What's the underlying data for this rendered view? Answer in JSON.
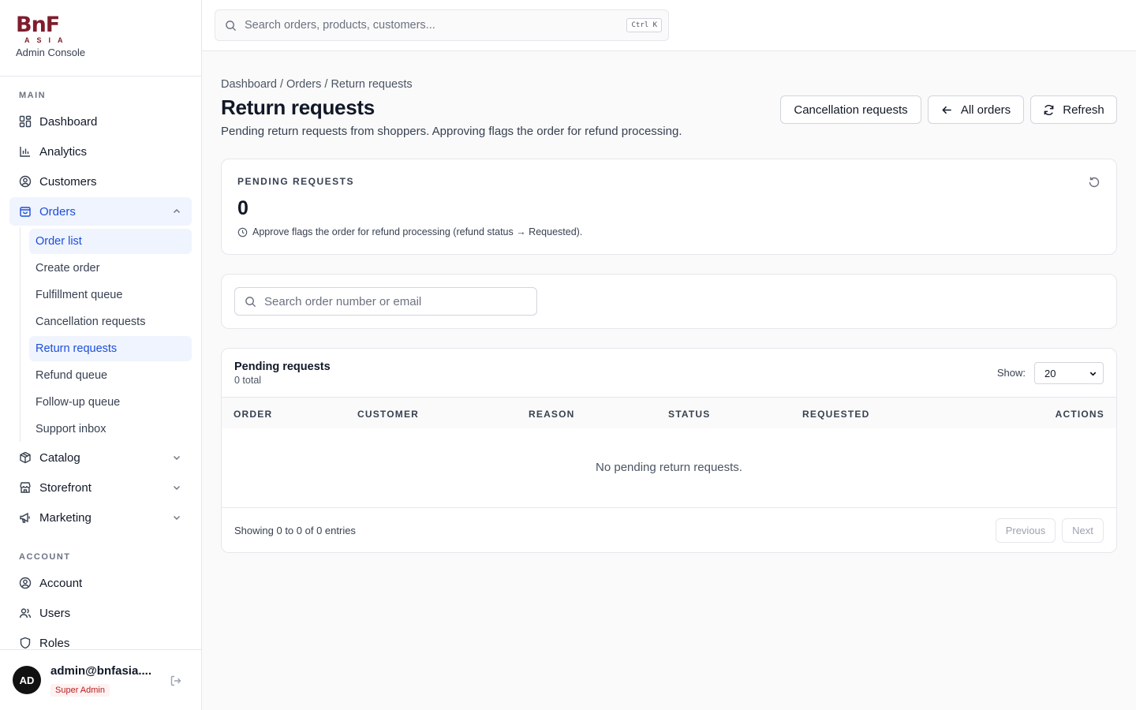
{
  "brand": {
    "logo_text": "BnF",
    "logo_sub": "ASIA",
    "caption": "Admin Console"
  },
  "search": {
    "placeholder": "Search orders, products, customers...",
    "shortcut": "Ctrl K"
  },
  "sidebar": {
    "main_label": "MAIN",
    "items": [
      {
        "label": "Dashboard",
        "icon": "dashboard-icon"
      },
      {
        "label": "Analytics",
        "icon": "bar-chart-icon"
      },
      {
        "label": "Customers",
        "icon": "user-circle-icon"
      },
      {
        "label": "Orders",
        "icon": "shopping-bag-icon",
        "expanded": true,
        "active": true
      },
      {
        "label": "Catalog",
        "icon": "box-icon"
      },
      {
        "label": "Storefront",
        "icon": "store-icon"
      },
      {
        "label": "Marketing",
        "icon": "megaphone-icon"
      }
    ],
    "orders_sub": [
      {
        "label": "Order list",
        "active": true
      },
      {
        "label": "Create order"
      },
      {
        "label": "Fulfillment queue"
      },
      {
        "label": "Cancellation requests"
      },
      {
        "label": "Return requests",
        "active": true
      },
      {
        "label": "Refund queue"
      },
      {
        "label": "Follow-up queue"
      },
      {
        "label": "Support inbox"
      }
    ],
    "account_label": "ACCOUNT",
    "account_items": [
      {
        "label": "Account",
        "icon": "user-circle-icon"
      },
      {
        "label": "Users",
        "icon": "users-icon"
      },
      {
        "label": "Roles",
        "icon": "shield-icon"
      }
    ]
  },
  "user": {
    "initials": "AD",
    "email": "admin@bnfasia....",
    "role": "Super Admin"
  },
  "breadcrumb": {
    "a": "Dashboard",
    "b": "Orders",
    "c": "Return requests",
    "sep": "/"
  },
  "page": {
    "title": "Return requests",
    "subtitle": "Pending return requests from shoppers. Approving flags the order for refund processing."
  },
  "actions": {
    "cancellation": "Cancellation requests",
    "all_orders": "All orders",
    "refresh": "Refresh"
  },
  "stat": {
    "label": "PENDING REQUESTS",
    "value": "0",
    "note": "Approve flags the order for refund processing (refund status → Requested)."
  },
  "filter": {
    "placeholder": "Search order number or email"
  },
  "table": {
    "title": "Pending requests",
    "count": "0 total",
    "show_label": "Show:",
    "page_size": "20",
    "columns": [
      "ORDER",
      "CUSTOMER",
      "REASON",
      "STATUS",
      "REQUESTED",
      "ACTIONS"
    ],
    "empty": "No pending return requests.",
    "entries": "Showing 0 to 0 of 0 entries",
    "prev": "Previous",
    "next": "Next"
  },
  "colors": {
    "brand": "#7f1d2d",
    "accent": "#1d4ed8",
    "active_bg": "#eff4fe"
  }
}
